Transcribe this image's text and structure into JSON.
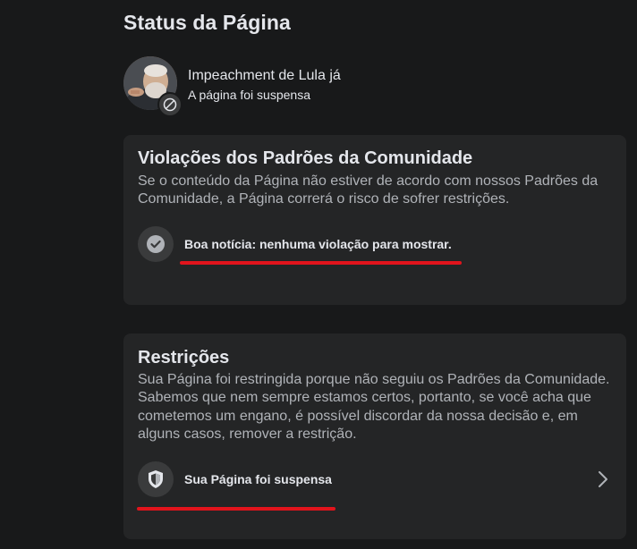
{
  "header": {
    "title": "Status da Página"
  },
  "page": {
    "name": "Impeachment de Lula já",
    "status": "A página foi suspensa"
  },
  "violations": {
    "title": "Violações dos Padrões da Comunidade",
    "description": "Se o conteúdo da Página não estiver de acordo com nossos Padrões da Comunidade, a Página correrá o risco de sofrer restrições.",
    "item_text": "Boa notícia: nenhuma violação para mostrar.",
    "item_icon": "check-circle-icon"
  },
  "restrictions": {
    "title": "Restrições",
    "description": "Sua Página foi restringida porque não seguiu os Padrões da Comunidade. Sabemos que nem sempre estamos certos, portanto, se você acha que cometemos um engano, é possível discordar da nossa decisão e, em alguns casos, remover a restrição.",
    "item_text": "Sua Página foi suspensa",
    "item_icon": "shield-icon"
  },
  "colors": {
    "background": "#18191a",
    "card": "#242526",
    "highlight_underline": "#e1141c"
  }
}
